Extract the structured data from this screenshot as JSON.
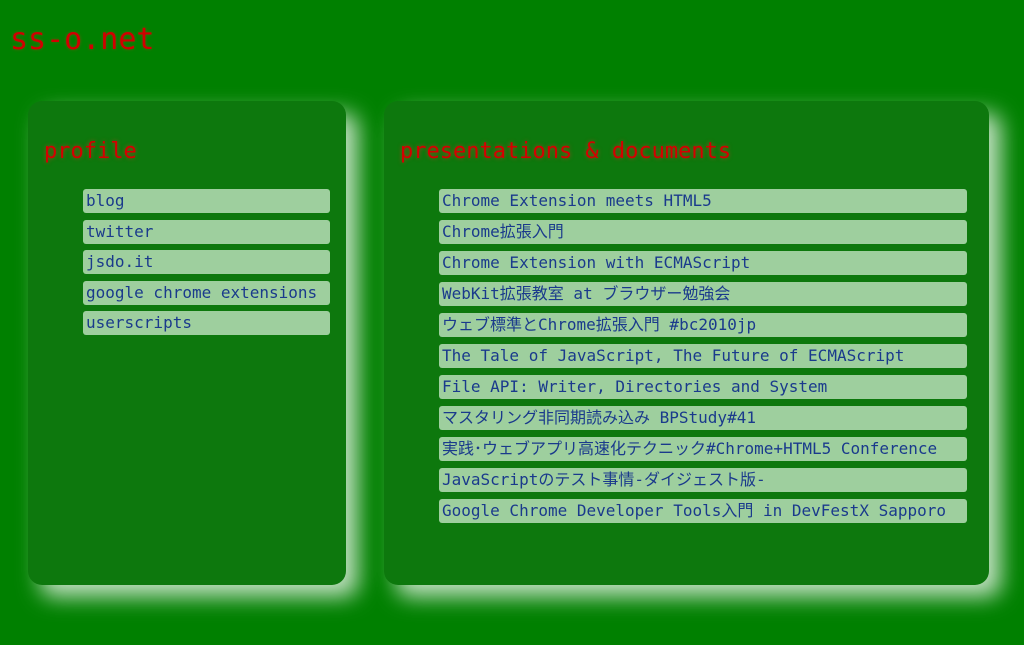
{
  "site": {
    "title": "ss-o.net"
  },
  "profile": {
    "heading": "profile",
    "links": [
      "blog",
      "twitter",
      "jsdo.it",
      "google chrome extensions",
      "userscripts"
    ]
  },
  "presentations": {
    "heading": "presentations & documents",
    "links": [
      "Chrome Extension meets HTML5",
      "Chrome拡張入門",
      "Chrome Extension with ECMAScript",
      "WebKit拡張教室 at ブラウザー勉強会",
      "ウェブ標準とChrome拡張入門 #bc2010jp",
      "The Tale of JavaScript, The Future of ECMAScript",
      "File API: Writer, Directories and System",
      "マスタリング非同期読み込み BPStudy#41",
      "実践･ウェブアプリ高速化テクニック#Chrome+HTML5 Conference",
      "JavaScriptのテスト事情-ダイジェスト版-",
      "Google Chrome Developer Tools入門 in DevFestX Sapporo"
    ]
  },
  "colors": {
    "background": "#008000",
    "panel": "#0d780d",
    "heading": "#d40000",
    "link_bg": "#9ecf9e",
    "link_text": "#1a3a8c"
  }
}
